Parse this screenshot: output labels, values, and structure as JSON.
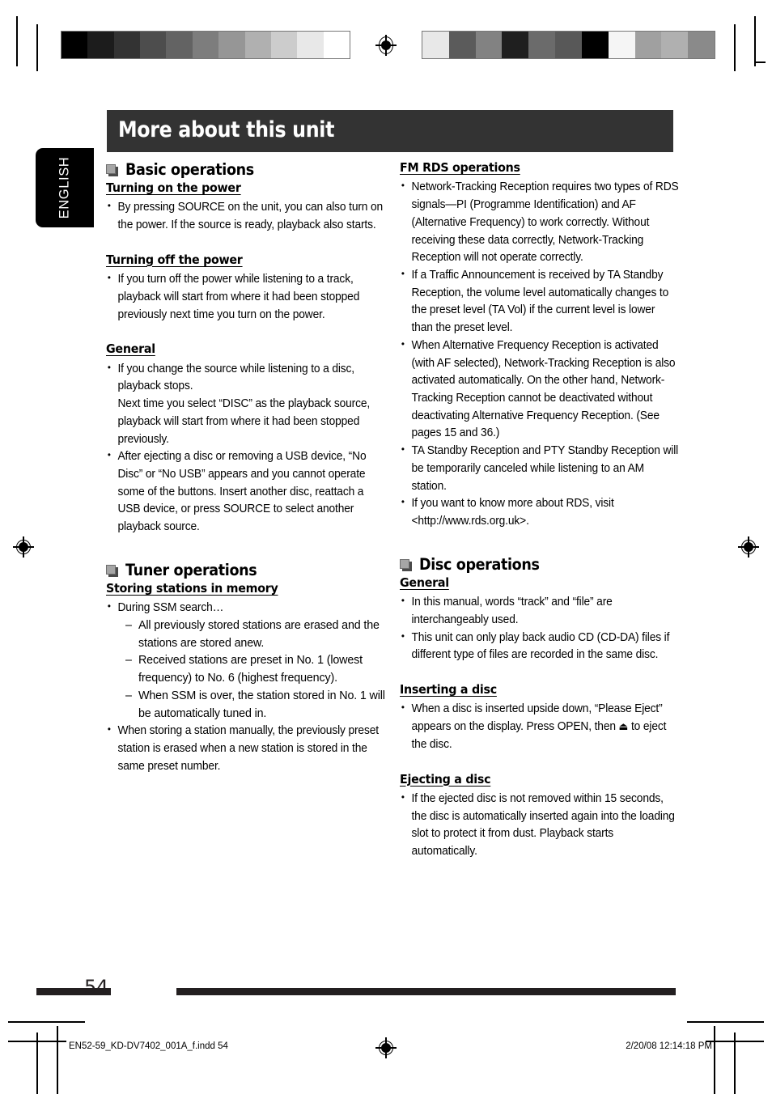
{
  "meta": {
    "language_tab": "ENGLISH",
    "page_number": "54",
    "footer_file": "EN52-59_KD-DV7402_001A_f.indd   54",
    "footer_date": "2/20/08   12:14:18 PM"
  },
  "header": {
    "title": "More about this unit",
    "bar_color": "#333333",
    "tab_color": "#000000"
  },
  "icons": {
    "section_square": "square-bullet-icon",
    "registration_mark": "registration-target-icon",
    "eject": "⏏"
  },
  "calibration": {
    "left_bar_swatches": [
      "#000000",
      "#1c1c1c",
      "#333333",
      "#4d4d4d",
      "#636363",
      "#7d7d7d",
      "#969696",
      "#b0b0b0",
      "#cccccc",
      "#e8e8e8",
      "#ffffff"
    ],
    "right_bar_swatches": [
      "#e8e8e8",
      "#5b5b5b",
      "#828282",
      "#1f1f1f",
      "#6b6b6b",
      "#585858",
      "#000000",
      "#f5f5f5",
      "#a0a0a0",
      "#b0b0b0",
      "#8a8a8a"
    ]
  },
  "left_column": {
    "sections": [
      {
        "type": "section",
        "title": "Basic operations",
        "subsections": [
          {
            "heading": "Turning on the power",
            "bullets": [
              "By pressing SOURCE on the unit, you can also turn on the power. If the source is ready, playback also starts."
            ]
          },
          {
            "heading": "Turning off the power",
            "bullets": [
              "If you turn off the power while listening to a track, playback will start from where it had been stopped previously next time you turn on the power."
            ]
          },
          {
            "heading": "General",
            "bullets": [
              "If you change the source while listening to a disc, playback stops.\nNext time you select “DISC” as the playback source, playback will start from where it had been stopped previously.",
              "After ejecting a disc or removing a USB device, “No Disc” or “No USB” appears and you cannot operate some of the buttons. Insert another disc, reattach a USB device, or press SOURCE to select another playback source."
            ]
          }
        ]
      },
      {
        "type": "section",
        "title": "Tuner operations",
        "subsections": [
          {
            "heading": "Storing stations in memory",
            "bullets": [
              "During SSM search…"
            ],
            "sub_dashes": [
              "All previously stored stations are erased and the stations are stored anew.",
              "Received stations are preset in No. 1 (lowest frequency) to No. 6 (highest frequency).",
              "When SSM is over, the station stored in No. 1 will be automatically tuned in."
            ],
            "bullets_after": [
              "When storing a station manually, the previously preset station is erased when a new station is stored in the same preset number."
            ]
          }
        ]
      }
    ]
  },
  "right_column": {
    "sections": [
      {
        "type": "subsection_only",
        "heading": "FM RDS operations",
        "bullets": [
          "Network-Tracking Reception requires two types of RDS signals—PI (Programme Identification) and AF (Alternative Frequency) to work correctly. Without receiving these data correctly, Network-Tracking Reception will not operate correctly.",
          "If a Traffic Announcement is received by TA Standby Reception, the volume level automatically changes to the preset level (TA Vol) if the current level is lower than the preset level.",
          "When Alternative Frequency Reception is activated (with AF selected), Network-Tracking Reception is also activated automatically. On the other hand, Network-Tracking Reception cannot be deactivated without deactivating Alternative Frequency Reception. (See pages 15 and 36.)",
          "TA Standby Reception and PTY Standby Reception will be temporarily canceled while listening to an AM station.",
          "If you want to know more about RDS, visit <http://www.rds.org.uk>."
        ]
      },
      {
        "type": "section",
        "title": "Disc operations",
        "subsections": [
          {
            "heading": "General",
            "bullets": [
              "In this manual, words “track” and “file” are interchangeably used.",
              "This unit can only play back audio CD (CD-DA) files if different type of files are recorded in the same disc."
            ]
          },
          {
            "heading": "Inserting a disc",
            "bullets_pre_glyph": "When a disc is inserted upside down, “Please Eject” appears on the display. Press OPEN, then ",
            "bullets_post_glyph": " to eject the disc."
          },
          {
            "heading": "Ejecting a disc",
            "bullets": [
              "If the ejected disc is not removed within 15 seconds, the disc is automatically inserted again into the loading slot to protect it from dust. Playback starts automatically."
            ]
          }
        ]
      }
    ]
  }
}
